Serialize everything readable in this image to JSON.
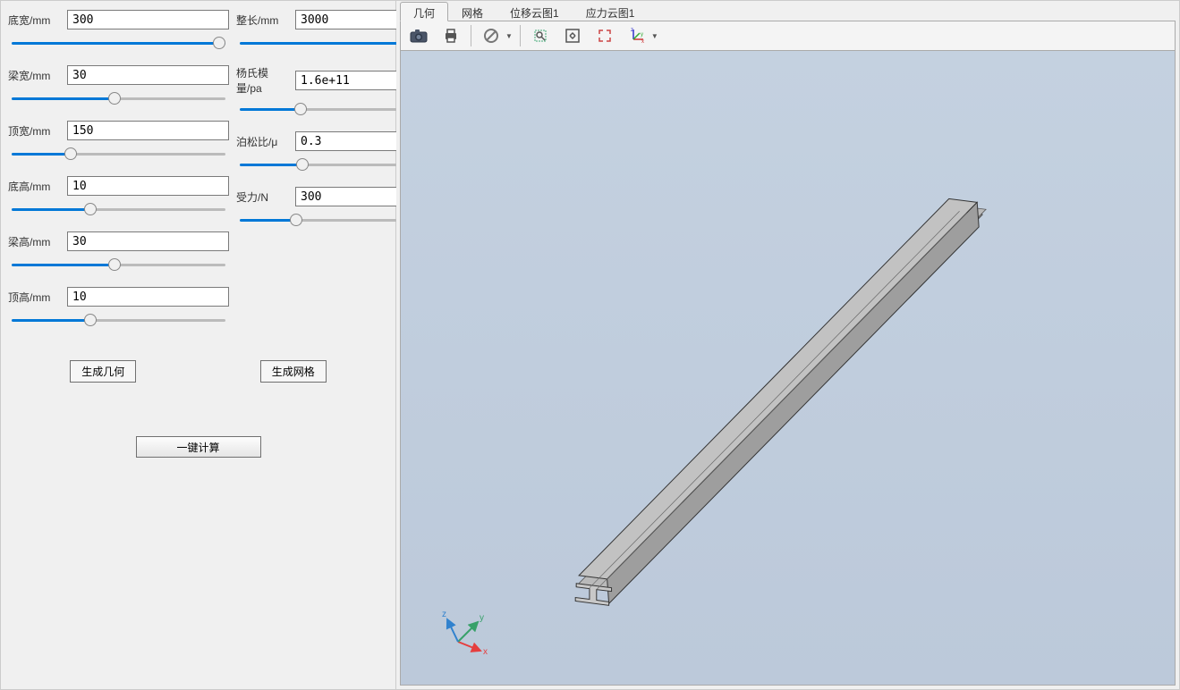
{
  "params": {
    "left": [
      {
        "label": "底宽/mm",
        "value": "300",
        "name": "bottom-width",
        "pct": 100
      },
      {
        "label": "梁宽/mm",
        "value": "30",
        "name": "beam-width",
        "pct": 48
      },
      {
        "label": "顶宽/mm",
        "value": "150",
        "name": "top-width",
        "pct": 26
      },
      {
        "label": "底高/mm",
        "value": "10",
        "name": "bottom-height",
        "pct": 36
      },
      {
        "label": "梁高/mm",
        "value": "30",
        "name": "beam-height",
        "pct": 48
      },
      {
        "label": "顶高/mm",
        "value": "10",
        "name": "top-height",
        "pct": 36
      }
    ],
    "right": [
      {
        "label": "整长/mm",
        "value": "3000",
        "name": "total-length",
        "pct": 100
      },
      {
        "label": "杨氏模量/pa",
        "value": "1.6e+11",
        "name": "young-modulus",
        "pct": 27
      },
      {
        "label": "泊松比/μ",
        "value": "0.3",
        "name": "poisson-ratio",
        "pct": 28
      },
      {
        "label": "受力/N",
        "value": "300",
        "name": "force",
        "pct": 25
      }
    ]
  },
  "buttons": {
    "gen_geometry": "生成几何",
    "gen_mesh": "生成网格",
    "compute": "一键计算"
  },
  "tabs": [
    {
      "label": "几何",
      "name": "geometry",
      "active": true
    },
    {
      "label": "网格",
      "name": "mesh",
      "active": false
    },
    {
      "label": "位移云图1",
      "name": "displacement-contour",
      "active": false
    },
    {
      "label": "应力云图1",
      "name": "stress-contour",
      "active": false
    }
  ],
  "toolbar": {
    "camera": "camera-icon",
    "print": "print-icon",
    "stop": "stop-icon",
    "zoom_box": "zoom-box-icon",
    "fit": "fit-view-icon",
    "fullscreen": "fullscreen-icon",
    "axes": "axes-icon"
  },
  "triad": {
    "x": "x",
    "y": "y",
    "z": "z"
  }
}
